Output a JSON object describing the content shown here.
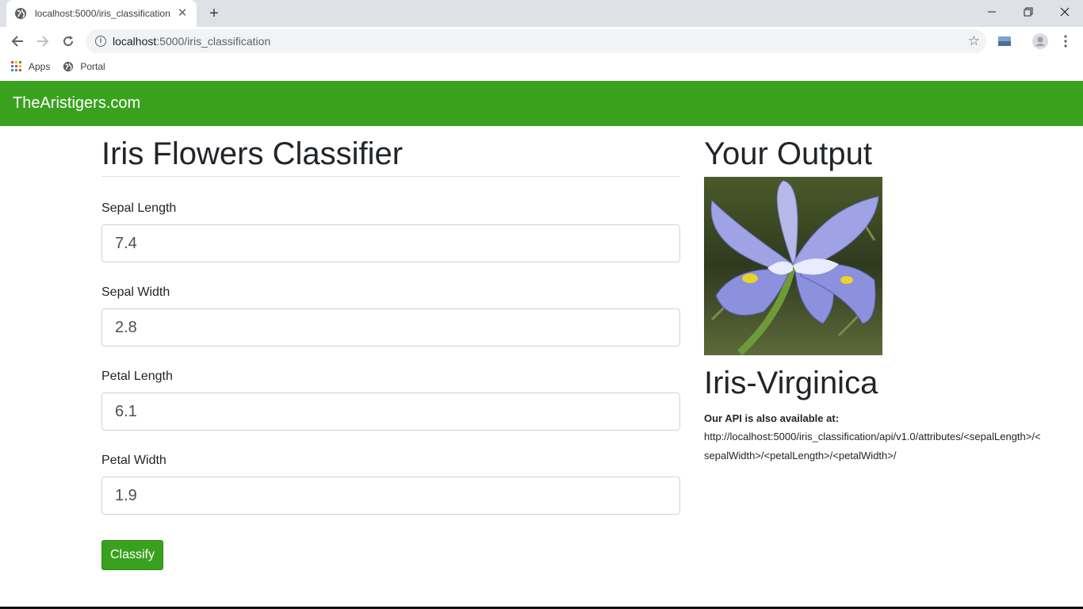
{
  "browser": {
    "tab_title": "localhost:5000/iris_classification",
    "url_host": "localhost",
    "url_rest": ":5000/iris_classification",
    "bookmarks": [
      {
        "label": "Apps",
        "icon": "apps-grid-icon"
      },
      {
        "label": "Portal",
        "icon": "globe-icon"
      }
    ]
  },
  "navbar": {
    "brand": "TheAristigers.com",
    "color": "#3aa11f"
  },
  "form": {
    "title": "Iris Flowers Classifier",
    "fields": [
      {
        "label": "Sepal Length",
        "value": "7.4"
      },
      {
        "label": "Sepal Width",
        "value": "2.8"
      },
      {
        "label": "Petal Length",
        "value": "6.1"
      },
      {
        "label": "Petal Width",
        "value": "1.9"
      }
    ],
    "submit_label": "Classify"
  },
  "output": {
    "title": "Your Output",
    "image_icon": "iris-flower-image",
    "prediction": "Iris-Virginica",
    "api_label": "Our API is also available at:",
    "api_url": "http://localhost:5000/iris_classification/api/v1.0/attributes/<sepalLength>/<sepalWidth>/<petalLength>/<petalWidth>/"
  }
}
